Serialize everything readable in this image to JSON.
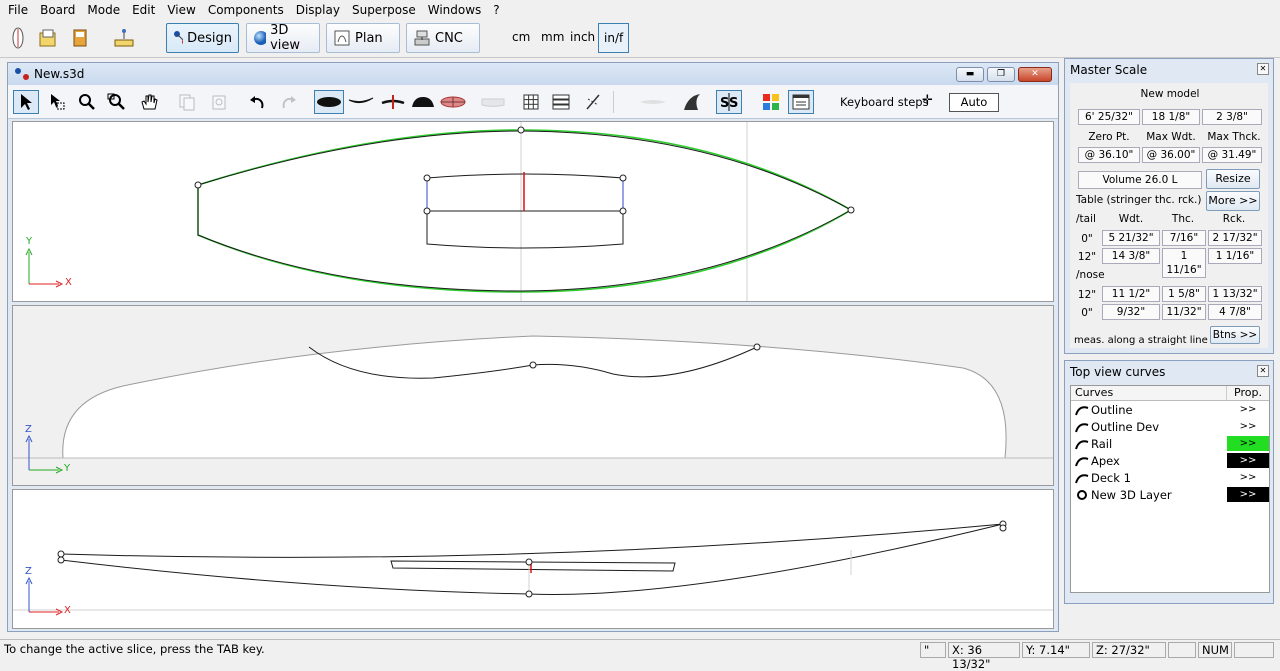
{
  "menubar": [
    "File",
    "Board",
    "Mode",
    "Edit",
    "View",
    "Components",
    "Display",
    "Superpose",
    "Windows",
    "?"
  ],
  "toolbar": {
    "modes": [
      {
        "label": "Design",
        "icon": "design-icon",
        "active": true
      },
      {
        "label": "3D view",
        "icon": "sphere-icon",
        "active": false
      },
      {
        "label": "Plan",
        "icon": "plan-icon",
        "active": false
      },
      {
        "label": "CNC",
        "icon": "cnc-icon",
        "active": false
      }
    ],
    "units": [
      "cm",
      "mm",
      "inch",
      "in/f"
    ],
    "active_unit": "in/f"
  },
  "document": {
    "title": "New.s3d",
    "window_buttons": [
      "minimize",
      "restore",
      "close"
    ],
    "keyboard_steps_label": "Keyboard steps",
    "auto_label": "Auto"
  },
  "views": {
    "top": {
      "axis_v": "Y",
      "axis_h": "X"
    },
    "section": {
      "axis_v": "Z",
      "axis_h": "Y"
    },
    "side": {
      "axis_v": "Z",
      "axis_h": "X"
    }
  },
  "master_scale": {
    "title": "Master Scale",
    "model_name": "New model",
    "dims": [
      "6' 25/32\"",
      "18 1/8\"",
      "2 3/8\""
    ],
    "headers": [
      "Zero Pt.",
      "Max Wdt.",
      "Max Thck."
    ],
    "positions": [
      "@ 36.10\"",
      "@ 36.00\"",
      "@ 31.49\""
    ],
    "volume": "Volume  26.0 L",
    "resize_label": "Resize",
    "more_label": "More >>",
    "table_title": "Table (stringer thc. rck.)",
    "tail_label": "/tail",
    "nose_label": "/nose",
    "col_headers": [
      "Wdt.",
      "Thc.",
      "Rck."
    ],
    "tail_rows": [
      {
        "pos": "0\"",
        "wdt": "5 21/32\"",
        "thc": "7/16\"",
        "rck": "2 17/32\""
      },
      {
        "pos": "12\"",
        "wdt": "14 3/8\"",
        "thc": "1 11/16\"",
        "rck": "1 1/16\""
      }
    ],
    "nose_rows": [
      {
        "pos": "12\"",
        "wdt": "11 1/2\"",
        "thc": "1 5/8\"",
        "rck": "1 13/32\""
      },
      {
        "pos": "0\"",
        "wdt": "9/32\"",
        "thc": "11/32\"",
        "rck": "4 7/8\""
      }
    ],
    "footer": "meas. along a straight line",
    "btns_label": "Btns >>"
  },
  "curves_panel": {
    "title": "Top view curves",
    "headers": [
      "Curves",
      "Prop."
    ],
    "items": [
      {
        "name": "Outline",
        "prop": ">>",
        "color": "#ffffff",
        "text": "#000000",
        "icon": "curve-icon"
      },
      {
        "name": "Outline Dev",
        "prop": ">>",
        "color": "#ffffff",
        "text": "#000000",
        "icon": "curve-icon"
      },
      {
        "name": "Rail",
        "prop": ">>",
        "color": "#22dd22",
        "text": "#000000",
        "icon": "curve-icon"
      },
      {
        "name": "Apex",
        "prop": ">>",
        "color": "#000000",
        "text": "#ffffff",
        "icon": "curve-icon"
      },
      {
        "name": "Deck 1",
        "prop": ">>",
        "color": "#ffffff",
        "text": "#000000",
        "icon": "curve-icon"
      },
      {
        "name": "New 3D Layer",
        "prop": ">>",
        "color": "#000000",
        "text": "#ffffff",
        "icon": "layer-icon"
      }
    ]
  },
  "status": {
    "message": "To change the active slice, press the TAB key.",
    "unit_mark": "\"",
    "x": "X: 36 13/32\"",
    "y": "Y: 7.14\"",
    "z": "Z: 27/32\"",
    "num": "NUM"
  }
}
